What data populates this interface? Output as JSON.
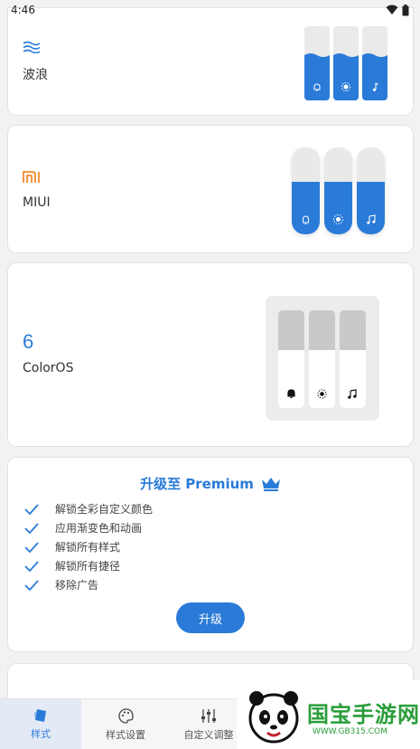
{
  "status_bar": {
    "time": "4:46"
  },
  "styles": [
    {
      "name": "波浪",
      "icon": "wave-icon"
    },
    {
      "name": "MIUI",
      "icon": "mi-logo-icon"
    },
    {
      "name": "ColorOS",
      "icon": "coloros-logo-icon"
    }
  ],
  "slider_icons": [
    "bell-icon",
    "brightness-icon",
    "music-note-icon"
  ],
  "premium": {
    "title": "升级至 Premium",
    "features": [
      "解锁全彩自定义颜色",
      "应用渐变色和动画",
      "解锁所有样式",
      "解锁所有捷径",
      "移除广告"
    ],
    "button_label": "升级"
  },
  "bottom_nav": [
    {
      "label": "样式",
      "icon": "style-icon",
      "active": true
    },
    {
      "label": "样式设置",
      "icon": "palette-icon",
      "active": false
    },
    {
      "label": "自定义调整",
      "icon": "sliders-icon",
      "active": false
    }
  ],
  "watermark": {
    "logo_text": "国宝手游网",
    "url": "WWW.GB315.COM"
  },
  "colors": {
    "accent": "#2a7bd8",
    "slider_track": "#e9e9e9",
    "coloros_track": "#c9c9c9"
  }
}
